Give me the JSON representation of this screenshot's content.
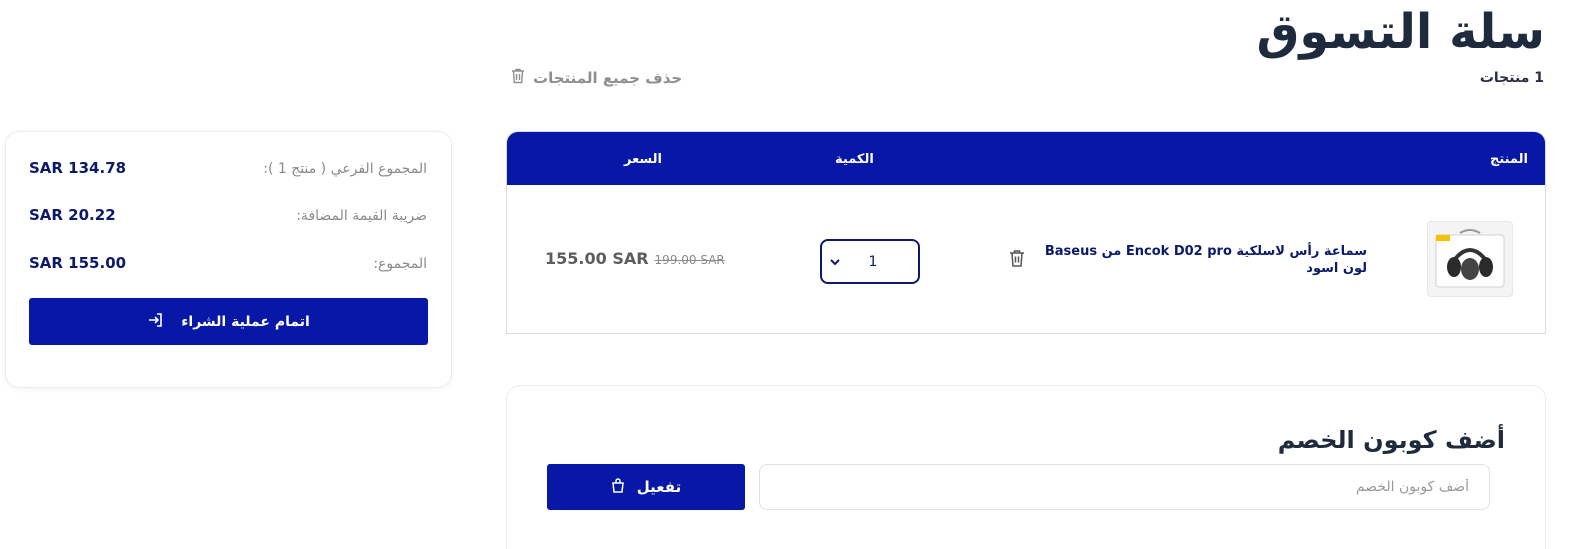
{
  "header": {
    "title": "سلة التسوق",
    "count_text": "1 منتجات",
    "delete_all_label": "حذف جميع المنتجات"
  },
  "table": {
    "columns": {
      "product": "المنتج",
      "quantity": "الكمية",
      "price": "السعر"
    },
    "item": {
      "name": "سماعة رأس لاسلكية Encok D02 pro من Baseus لون اسود",
      "quantity": "1",
      "old_price": "199.00 SAR",
      "new_price": "155.00 SAR",
      "image": "headphones-product-image"
    }
  },
  "summary": {
    "subtotal_label": "المجموع الفرعي ( منتج 1 ):",
    "subtotal_value": "SAR 134.78",
    "vat_label": "ضريبة القيمة المضافة:",
    "vat_value": "SAR 20.22",
    "total_label": "المجموع:",
    "total_value": "SAR 155.00",
    "checkout_label": "اتمام عملية الشراء"
  },
  "coupon": {
    "title": "أضف كوبون الخصم",
    "placeholder": "أضف كوبون الخصم",
    "activate_label": "تفعيل"
  },
  "colors": {
    "primary": "#0717a6",
    "heading": "#1e2b3c",
    "text_dark": "#0b1a6b",
    "muted": "#8a8a8a"
  }
}
